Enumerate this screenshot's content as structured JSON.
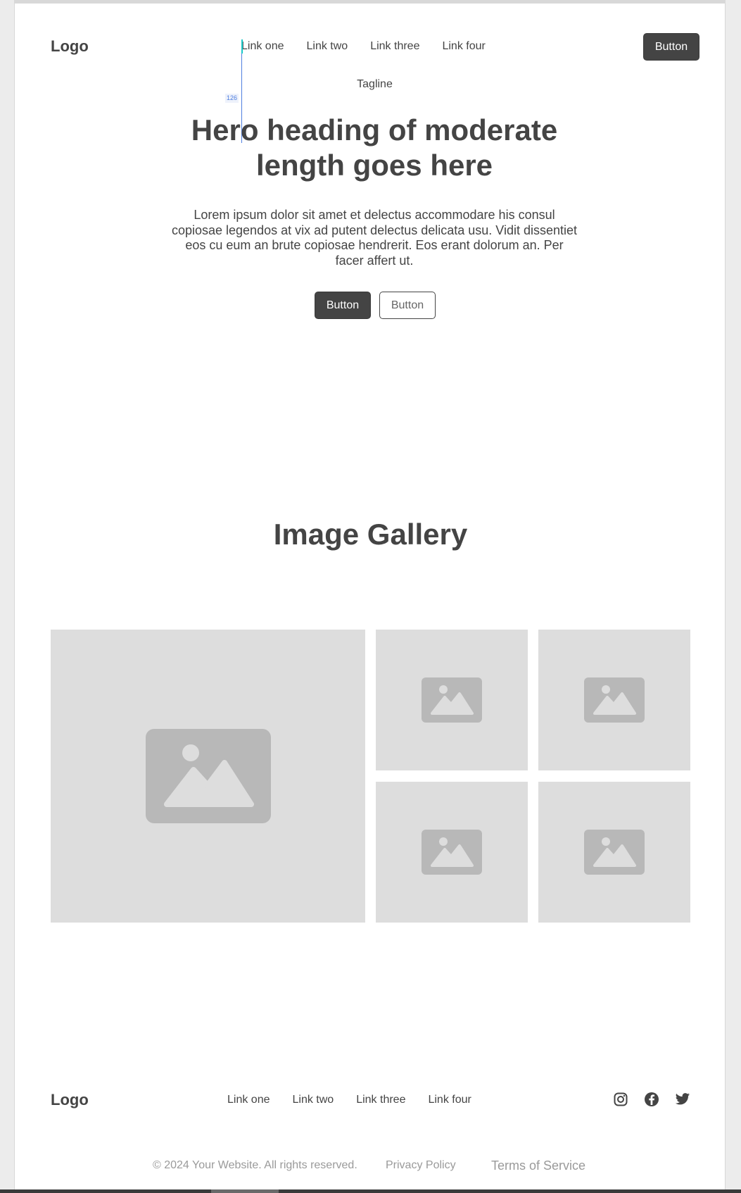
{
  "header": {
    "logo": "Logo",
    "nav": [
      "Link one",
      "Link two",
      "Link three",
      "Link four"
    ],
    "button_label": "Button"
  },
  "guide": {
    "measure_label": "126"
  },
  "hero": {
    "tagline": "Tagline",
    "heading": "Hero heading of moderate length goes here",
    "body": "Lorem ipsum dolor sit amet et delectus accommodare his consul copiosae legendos at vix ad putent delectus delicata usu. Vidit dissentiet eos cu eum an brute copiosae hendrerit. Eos erant dolorum an. Per facer affert ut.",
    "primary_button": "Button",
    "secondary_button": "Button"
  },
  "gallery": {
    "title": "Image Gallery",
    "images": [
      "image-placeholder-icon",
      "image-placeholder-icon",
      "image-placeholder-icon",
      "image-placeholder-icon",
      "image-placeholder-icon"
    ]
  },
  "footer": {
    "logo": "Logo",
    "nav": [
      "Link one",
      "Link two",
      "Link three",
      "Link four"
    ],
    "social": [
      "instagram-icon",
      "facebook-icon",
      "twitter-icon"
    ],
    "copyright": "© 2024 Your Website. All rights reserved.",
    "privacy": "Privacy Policy",
    "terms": "Terms of Service"
  },
  "colors": {
    "text": "#444444",
    "button_dark": "#444444",
    "placeholder_bg": "#dddddd",
    "placeholder_icon": "#b8b8b8",
    "guide": "#4f7fe0",
    "muted": "#9a9a9a"
  }
}
